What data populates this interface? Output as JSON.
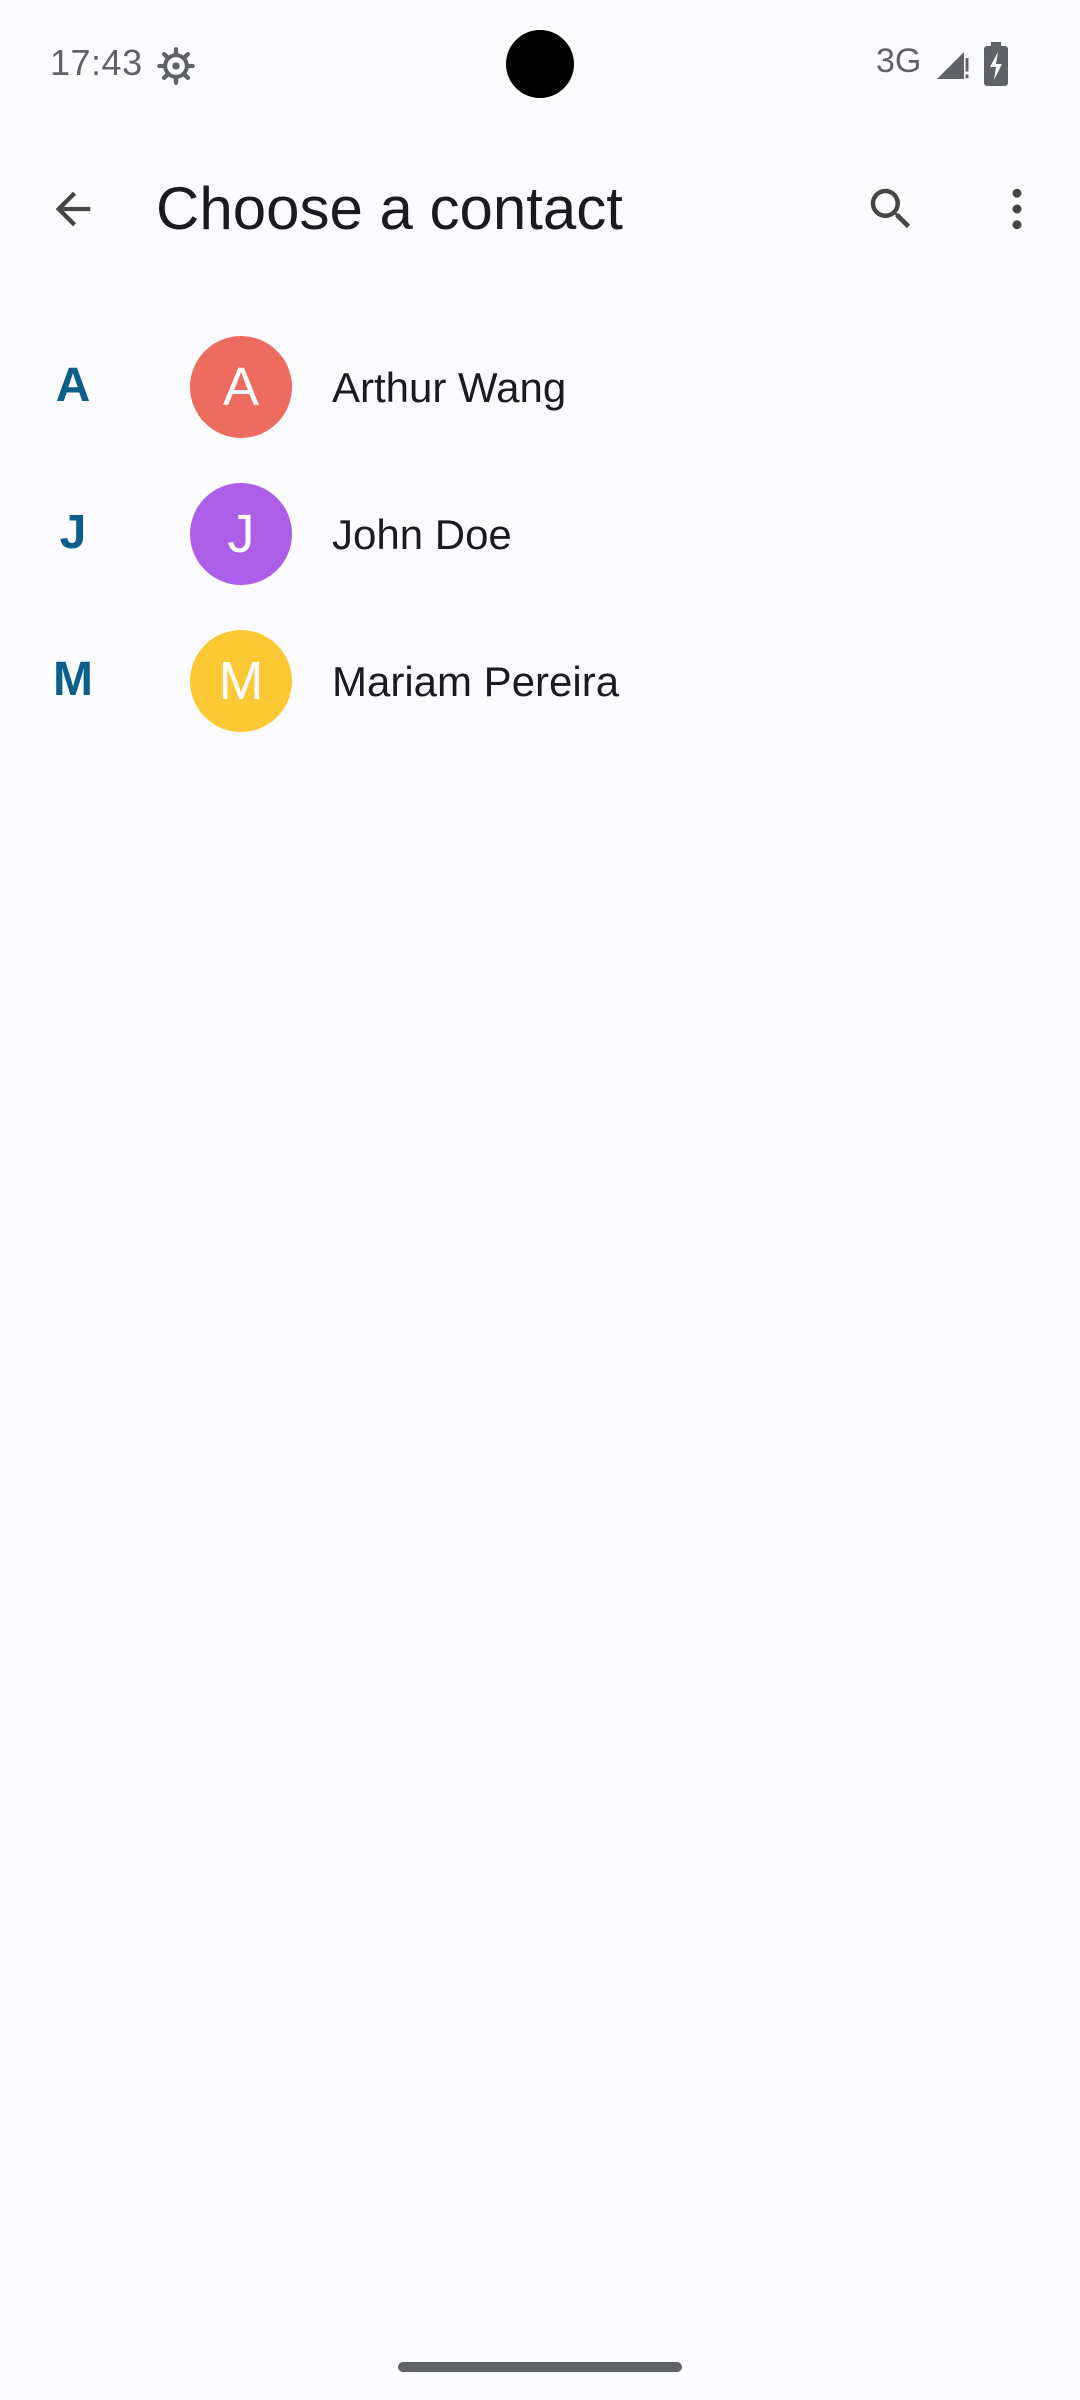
{
  "status_bar": {
    "time": "17:43",
    "network": "3G",
    "icons": [
      "settings-gear-icon",
      "signal-icon",
      "battery-charging-icon"
    ]
  },
  "app_bar": {
    "title": "Choose a contact",
    "back_icon": "arrow-back-icon",
    "search_icon": "search-icon",
    "more_icon": "more-vert-icon"
  },
  "contacts": [
    {
      "section": "A",
      "initial": "A",
      "name": "Arthur Wang",
      "avatar_color": "#ee6b60"
    },
    {
      "section": "J",
      "initial": "J",
      "name": "John Doe",
      "avatar_color": "#ad5ee8"
    },
    {
      "section": "M",
      "initial": "M",
      "name": "Mariam Pereira",
      "avatar_color": "#fcc934"
    }
  ],
  "colors": {
    "background": "#fcfcff",
    "section_letter": "#0b5f8a",
    "text_primary": "#1b1b1f",
    "icon": "#444746"
  }
}
